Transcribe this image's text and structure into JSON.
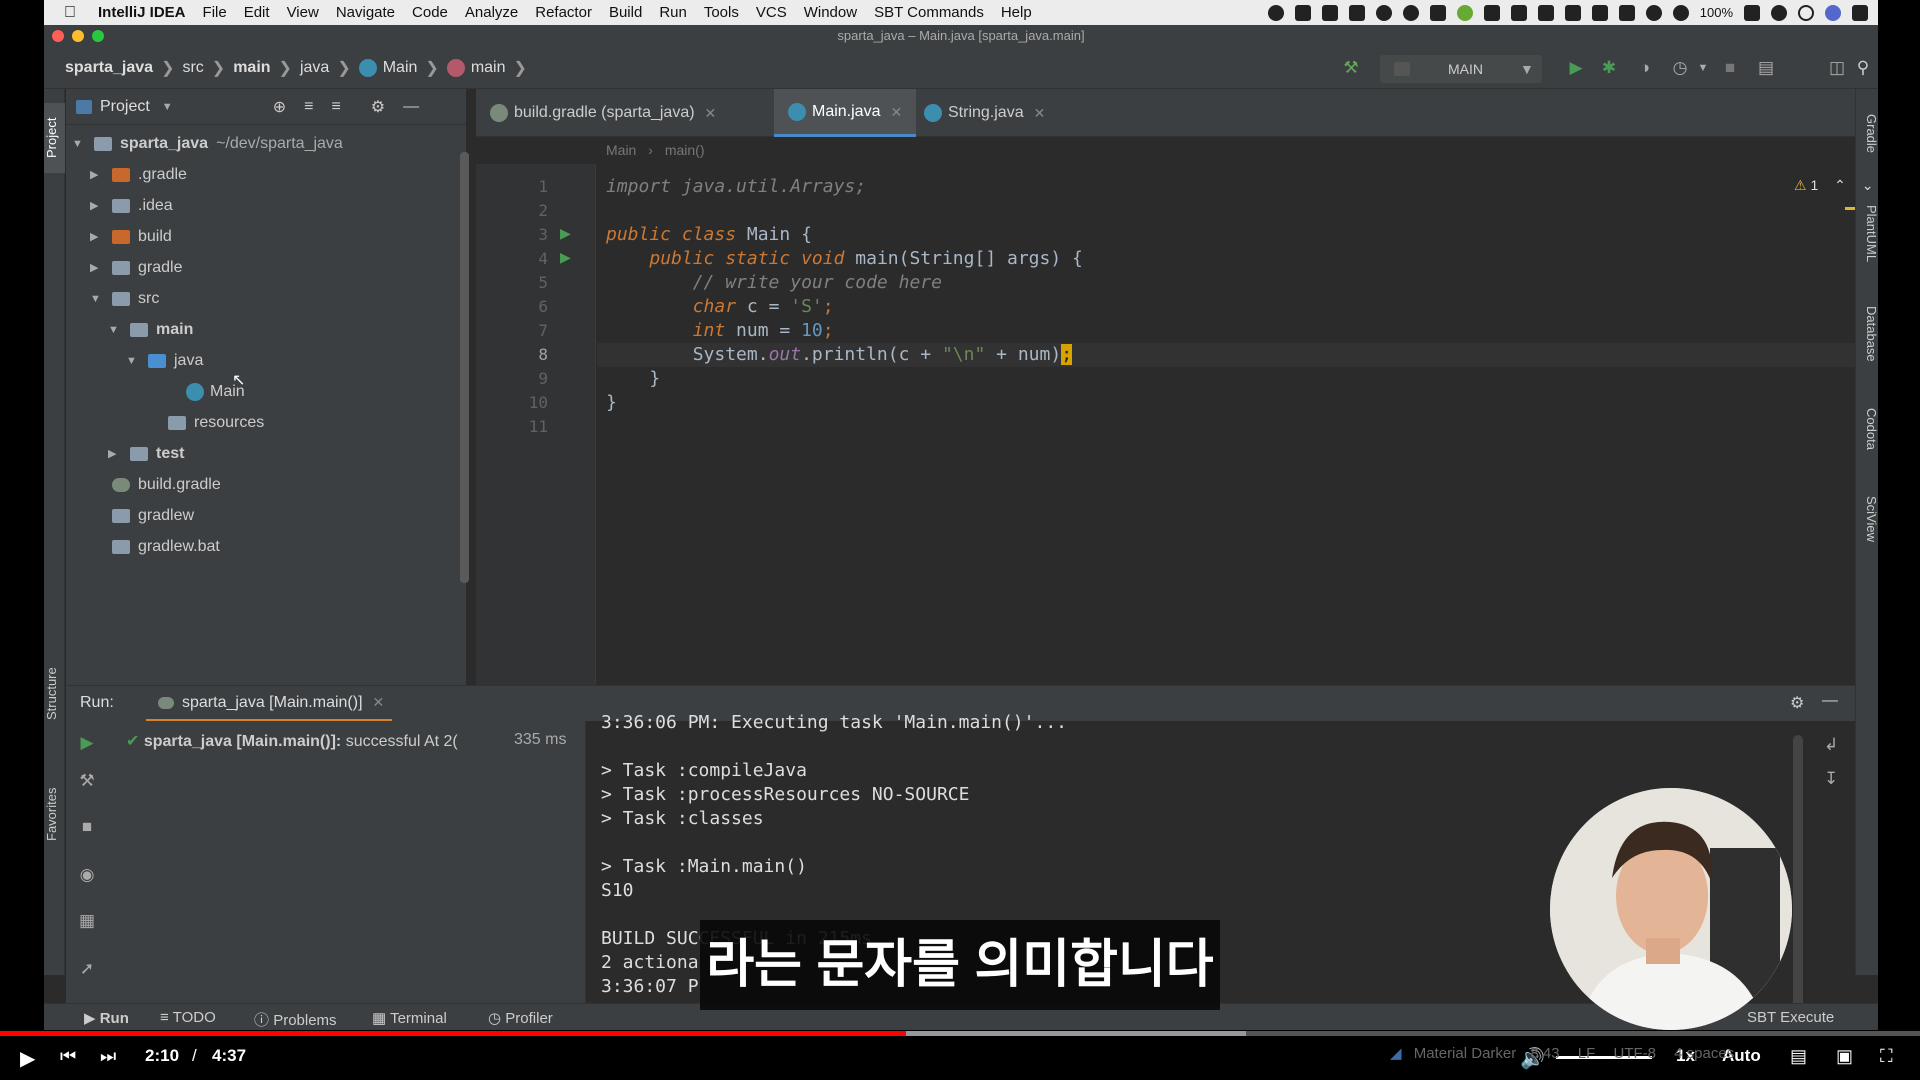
{
  "menubar": {
    "app_name": "IntelliJ IDEA",
    "items": [
      "File",
      "Edit",
      "View",
      "Navigate",
      "Code",
      "Analyze",
      "Refactor",
      "Build",
      "Run",
      "Tools",
      "VCS",
      "Window",
      "SBT Commands",
      "Help"
    ],
    "battery": "100%"
  },
  "window": {
    "title": "sparta_java – Main.java [sparta_java.main]"
  },
  "navbar": {
    "crumbs": [
      "sparta_java",
      "src",
      "main",
      "java",
      "Main",
      "main"
    ],
    "run_config": "MAIN"
  },
  "project": {
    "header": "Project",
    "root_name": "sparta_java",
    "root_path": "~/dev/sparta_java",
    "items": [
      ".gradle",
      ".idea",
      "build",
      "gradle",
      "src",
      "main",
      "java",
      "Main",
      "resources",
      "test",
      "build.gradle",
      "gradlew",
      "gradlew.bat"
    ]
  },
  "editor": {
    "tabs": [
      "build.gradle (sparta_java)",
      "Main.java",
      "String.java"
    ],
    "breadcrumb": [
      "Main",
      "main()"
    ],
    "warning_count": "1",
    "line_numbers": [
      "1",
      "2",
      "3",
      "4",
      "5",
      "6",
      "7",
      "8",
      "9",
      "10",
      "11"
    ],
    "lines": {
      "l1": "import java.util.Arrays;",
      "l3_kw": "public class",
      "l3_name": " Main {",
      "l4_kw": "public static void",
      "l4_rest": " main(String[] args) {",
      "l5": "// write your code here",
      "l6_kw": "char",
      "l6_a": " c = ",
      "l6_str": "'S'",
      "l6_b": ";",
      "l7_kw": "int",
      "l7_a": " num = ",
      "l7_num": "10",
      "l7_b": ";",
      "l8_a": "System.",
      "l8_fld": "out",
      "l8_b": ".println(c + ",
      "l8_str": "\"\\n\"",
      "l8_c": " + num)",
      "l8_d": ";",
      "l9": "}",
      "l10": "}"
    }
  },
  "run": {
    "label": "Run:",
    "tab": "sparta_java [Main.main()]",
    "tree_item": "sparta_java [Main.main()]:",
    "tree_status": "successful At 2(",
    "tree_time": "335 ms",
    "console": [
      "3:36:06 PM: Executing task 'Main.main()'...",
      "",
      "> Task :compileJava",
      "> Task :processResources NO-SOURCE",
      "> Task :classes",
      "",
      "> Task :Main.main()",
      "S10",
      "",
      "BUILD SUCCESSFUL in 215ms",
      "2 actiona",
      "3:36:07 P"
    ]
  },
  "bottom_tools": {
    "run": "Run",
    "todo": "TODO",
    "problems": "Problems",
    "terminal": "Terminal",
    "profiler": "Profiler",
    "sbt": "SBT Execute"
  },
  "left_stripe": {
    "project": "Project",
    "structure": "Structure",
    "favorites": "Favorites"
  },
  "right_stripe": {
    "gradle": "Gradle",
    "plantuml": "PlantUML",
    "database": "Database",
    "codota": "Codota",
    "sciview": "SciView"
  },
  "status_bar": {
    "theme": "Material Darker",
    "position": "8:43",
    "line_sep": "LF",
    "encoding": "UTF-8",
    "indent": "4 spaces"
  },
  "subtitle": "라는 문자를 의미합니다",
  "video": {
    "current_time": "2:10",
    "separator": "/",
    "duration": "4:37",
    "speed": "1x",
    "quality": "Auto",
    "progress_fraction": 0.472
  },
  "colors": {
    "accent": "#4a88c7",
    "progress": "#ff0000",
    "run_green": "#499c54"
  }
}
